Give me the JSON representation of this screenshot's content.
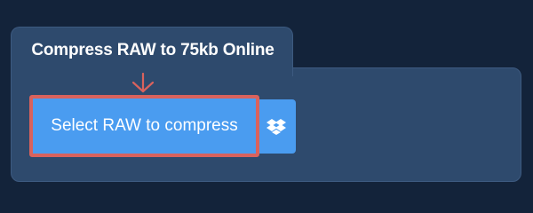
{
  "uploader": {
    "title": "Compress RAW to 75kb Online",
    "select_button_label": "Select RAW to compress",
    "dropbox_icon": "dropbox-icon",
    "arrow_icon": "arrow-down-icon"
  },
  "colors": {
    "page_background": "#13233a",
    "card_background": "#2e4a6d",
    "button_background": "#4a9cf0",
    "highlight_border": "#d9625d",
    "text": "#ffffff"
  }
}
